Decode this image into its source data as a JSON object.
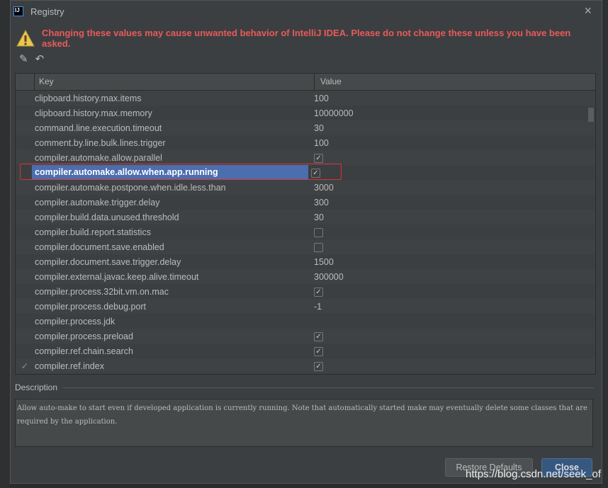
{
  "window": {
    "title": "Registry",
    "close_icon": "×"
  },
  "warning": "Changing these values may cause unwanted behavior of IntelliJ IDEA. Please do not change these unless you have been asked.",
  "toolbar": {
    "edit_icon": "✎",
    "revert_icon": "↶"
  },
  "table": {
    "headers": {
      "key": "Key",
      "value": "Value"
    },
    "rows": [
      {
        "key": "clipboard.history.max.items",
        "value": "100"
      },
      {
        "key": "clipboard.history.max.memory",
        "value": "10000000"
      },
      {
        "key": "command.line.execution.timeout",
        "value": "30"
      },
      {
        "key": "comment.by.line.bulk.lines.trigger",
        "value": "100"
      },
      {
        "key": "compiler.automake.allow.parallel",
        "check": true
      },
      {
        "key": "compiler.automake.allow.when.app.running",
        "check": true,
        "selected": true
      },
      {
        "key": "compiler.automake.postpone.when.idle.less.than",
        "value": "3000"
      },
      {
        "key": "compiler.automake.trigger.delay",
        "value": "300"
      },
      {
        "key": "compiler.build.data.unused.threshold",
        "value": "30"
      },
      {
        "key": "compiler.build.report.statistics",
        "check": false
      },
      {
        "key": "compiler.document.save.enabled",
        "check": false
      },
      {
        "key": "compiler.document.save.trigger.delay",
        "value": "1500"
      },
      {
        "key": "compiler.external.javac.keep.alive.timeout",
        "value": "300000"
      },
      {
        "key": "compiler.process.32bit.vm.on.mac",
        "check": true
      },
      {
        "key": "compiler.process.debug.port",
        "value": "-1"
      },
      {
        "key": "compiler.process.jdk",
        "value": ""
      },
      {
        "key": "compiler.process.preload",
        "check": true
      },
      {
        "key": "compiler.ref.chain.search",
        "check": true
      },
      {
        "key": "compiler.ref.index",
        "check": true,
        "modified": true
      }
    ]
  },
  "description": {
    "label": "Description",
    "text": "Allow auto-make to start even if developed application is currently running. Note that automatically started make may eventually delete some classes that are required by the application."
  },
  "buttons": {
    "restore": "Restore Defaults",
    "close": "Close"
  },
  "watermark": "https://blog.csdn.net/seek_of"
}
